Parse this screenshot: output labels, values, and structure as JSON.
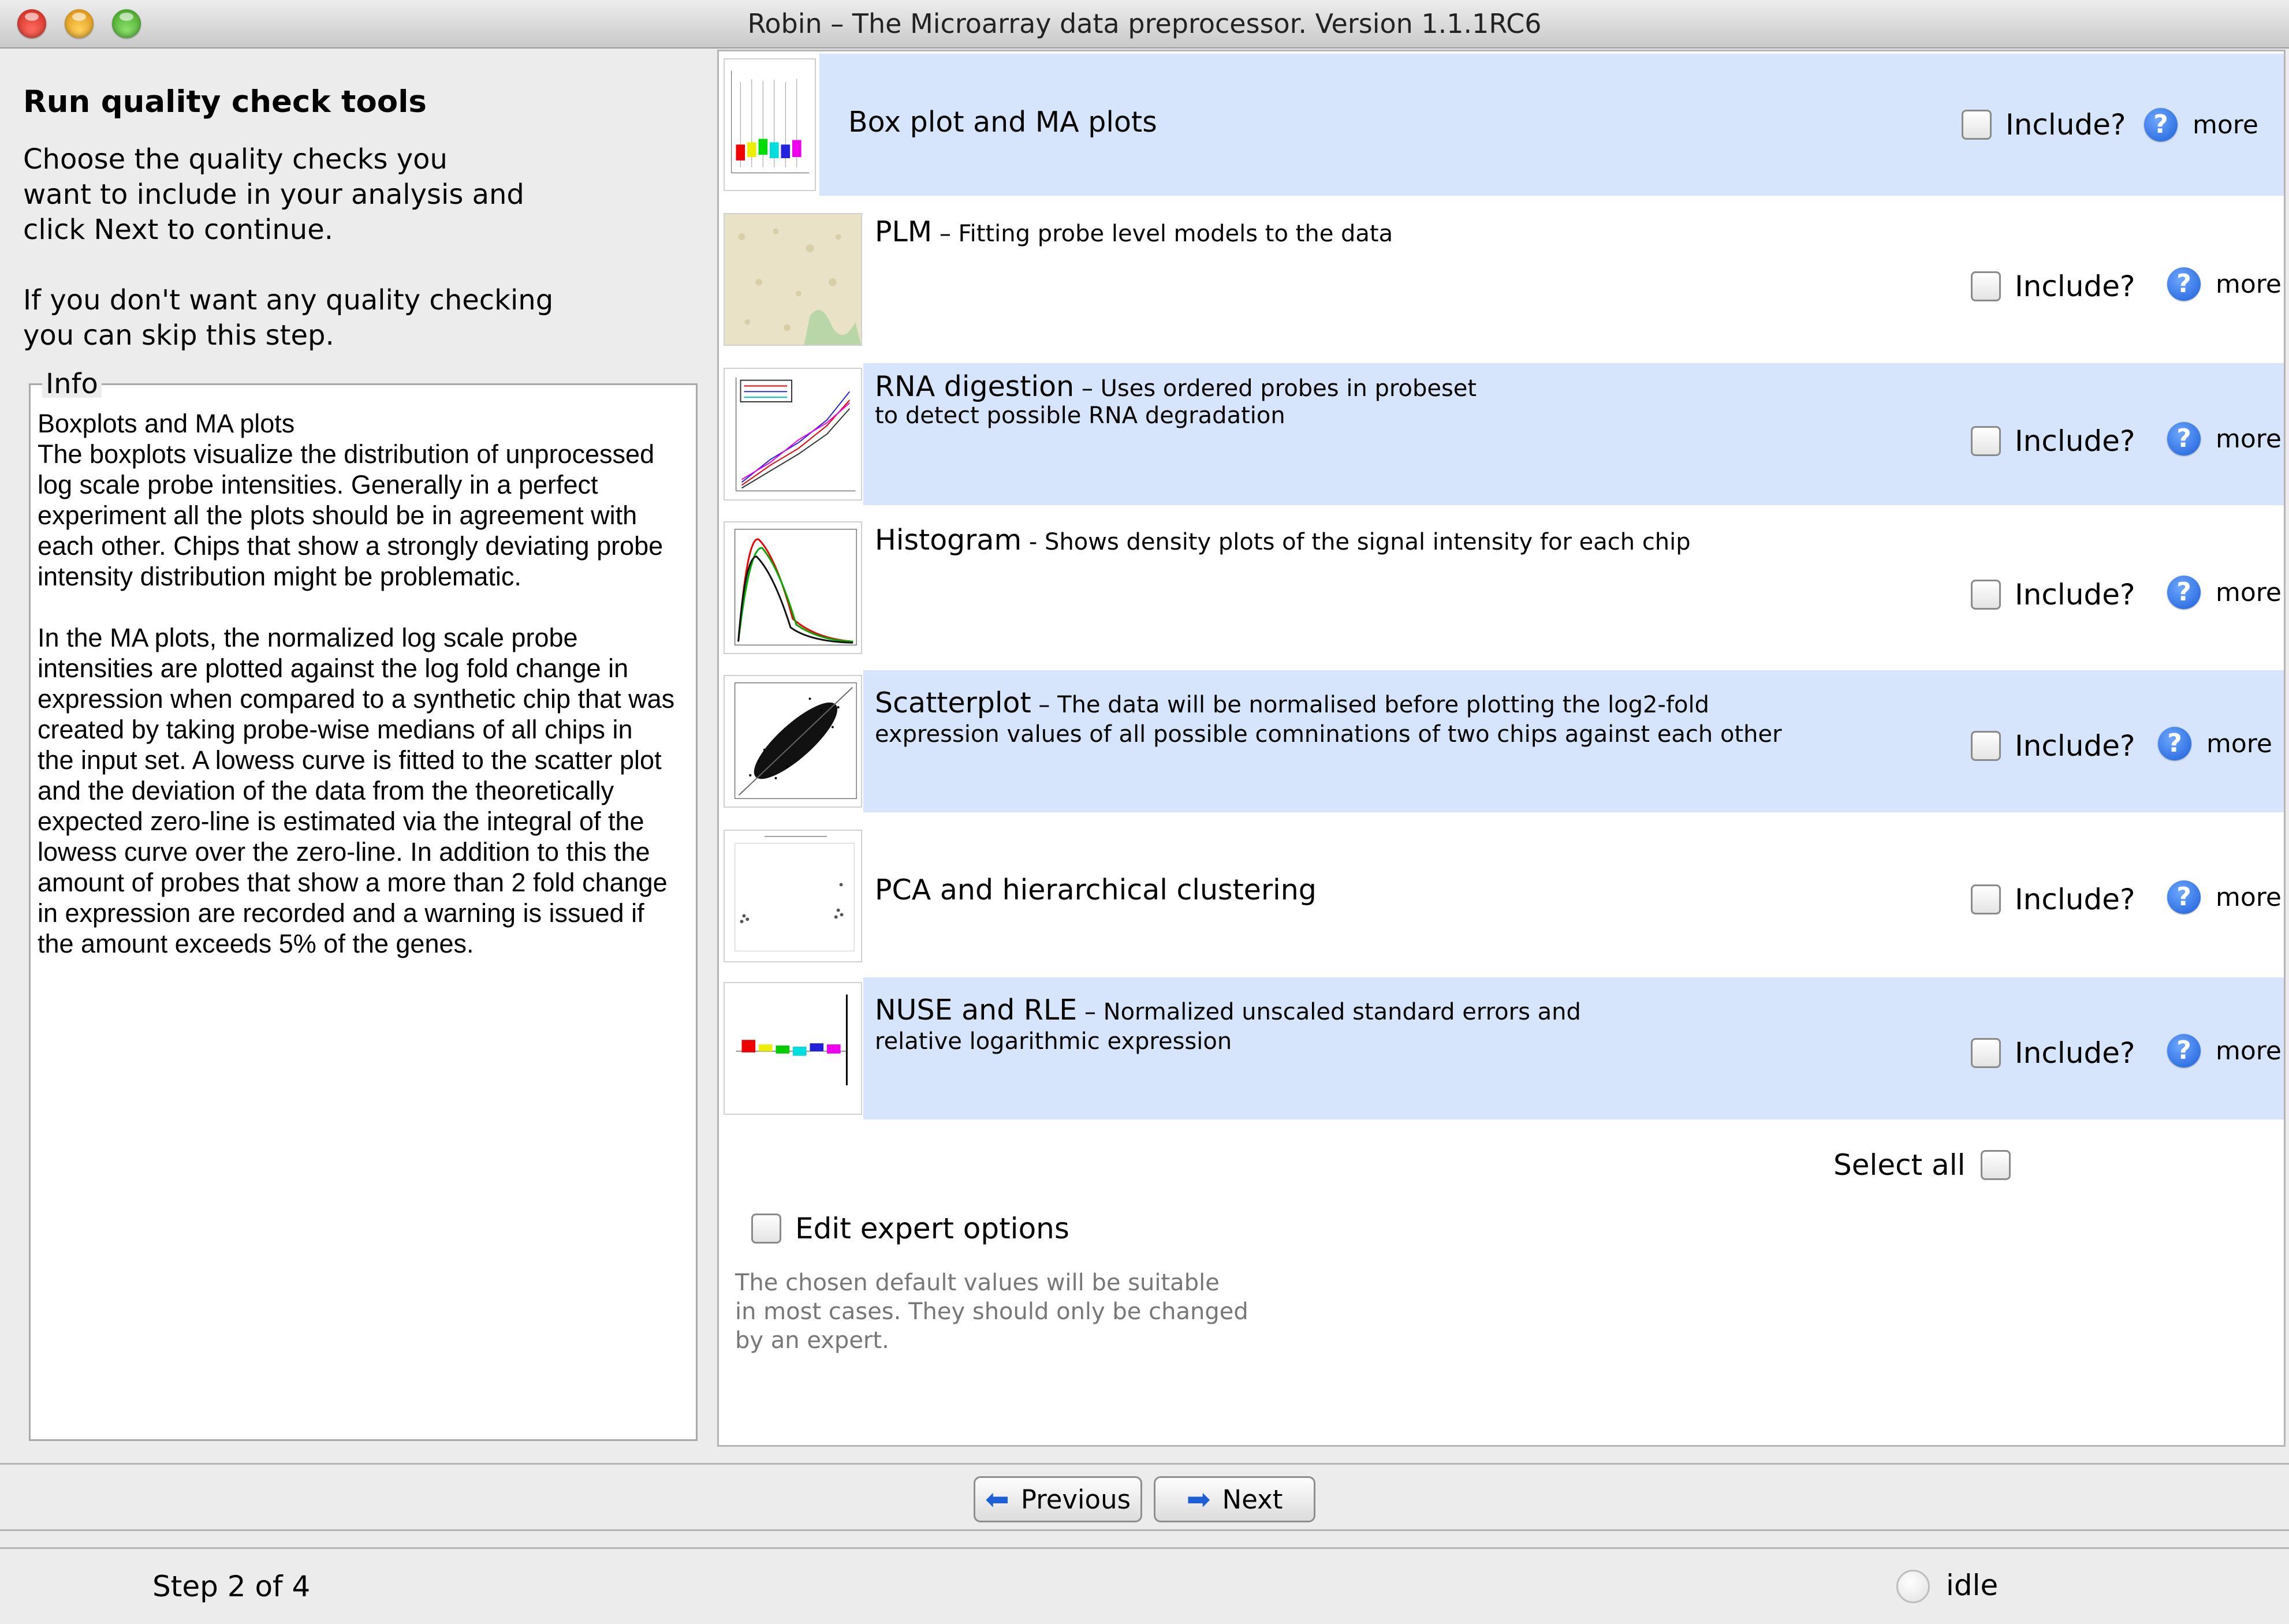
{
  "window": {
    "title": "Robin – The Microarray data preprocessor. Version 1.1.1RC6"
  },
  "left": {
    "heading": "Run quality check tools",
    "intro": "Choose the quality checks you\nwant to include in your analysis and\nclick Next to continue.\n\nIf you don't want any quality checking\nyou can skip this step.",
    "info_legend": "Info",
    "info_text": "Boxplots and MA plots\nThe boxplots visualize the distribution of unprocessed\nlog scale probe intensities. Generally in a perfect\nexperiment all the plots should be in agreement with\neach other. Chips that show a strongly deviating probe\nintensity distribution might be problematic.\n\nIn the MA plots, the normalized log scale probe\nintensities are plotted against the log fold change in\nexpression when compared to a synthetic chip that was\ncreated by taking probe-wise medians of all chips in\nthe input set. A lowess curve is fitted to the scatter plot\nand the deviation of the data from the theoretically\nexpected zero-line is estimated via the integral of the\nlowess curve over the zero-line. In addition to this the\namount of probes that show a more than 2 fold change\nin expression are recorded and a warning is issued if\nthe amount exceeds 5% of the genes."
  },
  "qc_items": [
    {
      "title": "Box plot and MA plots",
      "desc": "",
      "desc2": "",
      "include_label": "Include?",
      "more_label": "more",
      "checked": false,
      "highlighted": true
    },
    {
      "title": "PLM",
      "desc": " – Fitting probe level models to the data",
      "desc2": "",
      "include_label": "Include?",
      "more_label": "more",
      "checked": false,
      "highlighted": false
    },
    {
      "title": "RNA digestion",
      "desc": " – Uses ordered probes in probeset",
      "desc2": "to detect possible RNA degradation",
      "include_label": "Include?",
      "more_label": "more",
      "checked": false,
      "highlighted": true
    },
    {
      "title": "Histogram",
      "desc": " - Shows density plots of the signal intensity for each chip",
      "desc2": "",
      "include_label": "Include?",
      "more_label": "more",
      "checked": false,
      "highlighted": false
    },
    {
      "title": "Scatterplot",
      "desc": " – The data will be normalised before plotting the log2-fold",
      "desc2": "expression values of all possible comninations of two chips against each other",
      "include_label": "Include?",
      "more_label": "more",
      "checked": false,
      "highlighted": true
    },
    {
      "title": "PCA and hierarchical clustering",
      "desc": "",
      "desc2": "",
      "include_label": "Include?",
      "more_label": "more",
      "checked": false,
      "highlighted": false
    },
    {
      "title": "NUSE and RLE",
      "desc": " – Normalized unscaled standard errors and",
      "desc2": "relative logarithmic expression",
      "include_label": "Include?",
      "more_label": "more",
      "checked": false,
      "highlighted": true
    }
  ],
  "select_all": {
    "label": "Select all",
    "checked": false
  },
  "expert": {
    "label": "Edit expert options",
    "checked": false,
    "note": "The chosen default values will be suitable\nin most cases. They should only be changed\nby an expert."
  },
  "nav": {
    "previous_label": "Previous",
    "next_label": "Next"
  },
  "status": {
    "step": "Step 2 of 4",
    "state": "idle"
  },
  "colors": {
    "row_highlight": "#d6e5fb",
    "help_icon": "#1a5fd8"
  }
}
